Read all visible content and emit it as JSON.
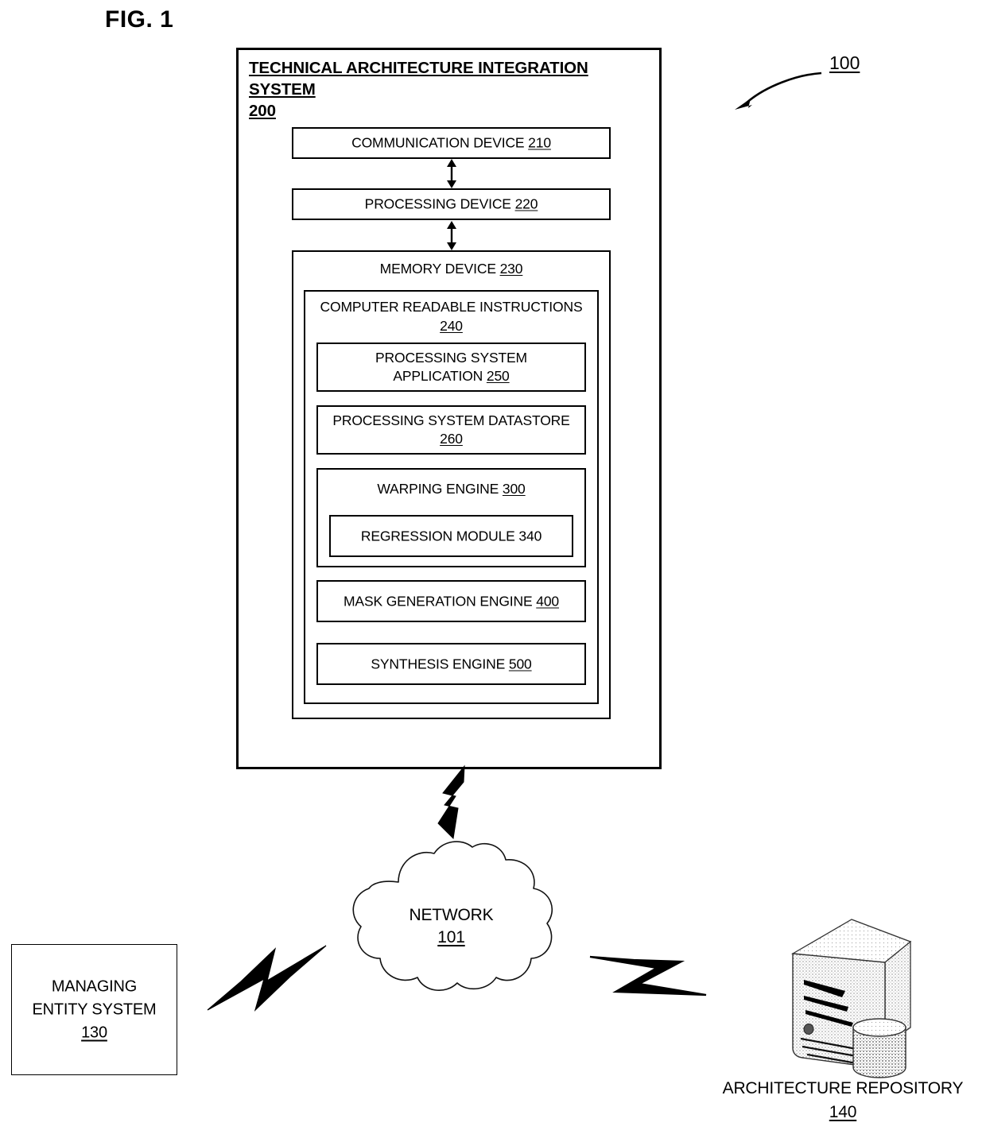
{
  "figure": {
    "label": "FIG. 1",
    "reference_numeral": "100"
  },
  "system": {
    "title_line1": "TECHNICAL ARCHITECTURE INTEGRATION",
    "title_line2": "SYSTEM",
    "title_ref": "200",
    "components": {
      "communication_device": {
        "label": "COMMUNICATION DEVICE",
        "ref": "210"
      },
      "processing_device": {
        "label": "PROCESSING DEVICE",
        "ref": "220"
      },
      "memory_device": {
        "label": "MEMORY DEVICE",
        "ref": "230"
      },
      "computer_readable_instructions": {
        "label_line1": "COMPUTER READABLE INSTRUCTIONS",
        "ref": "240"
      },
      "processing_system_application": {
        "label_line1": "PROCESSING SYSTEM",
        "label_line2": "APPLICATION",
        "ref": "250"
      },
      "processing_system_datastore": {
        "label_line1": "PROCESSING SYSTEM DATASTORE",
        "ref": "260"
      },
      "warping_engine": {
        "label": "WARPING ENGINE",
        "ref": "300"
      },
      "regression_module": {
        "label": "REGRESSION MODULE 340"
      },
      "mask_generation_engine": {
        "label": "MASK GENERATION ENGINE",
        "ref": "400"
      },
      "synthesis_engine": {
        "label": "SYNTHESIS ENGINE",
        "ref": "500"
      }
    }
  },
  "network": {
    "label": "NETWORK",
    "ref": "101"
  },
  "managing_entity_system": {
    "label_line1": "MANAGING",
    "label_line2": "ENTITY SYSTEM",
    "ref": "130"
  },
  "architecture_repository": {
    "label": "ARCHITECTURE REPOSITORY",
    "ref": "140"
  },
  "colors": {
    "stroke": "#000000",
    "background": "#ffffff"
  }
}
